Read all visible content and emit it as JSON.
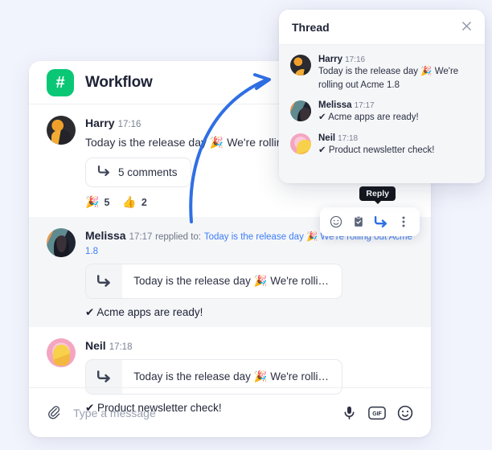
{
  "channel": {
    "icon": "hash-icon",
    "name": "Workflow",
    "accent_color": "#0ac776"
  },
  "messages": [
    {
      "author": "Harry",
      "time": "17:16",
      "text": "Today is the release day 🎉 We're rolling out Acme 1.8",
      "comments_label": "5 comments",
      "reactions": [
        {
          "emoji": "🎉",
          "count": "5"
        },
        {
          "emoji": "👍",
          "count": "2"
        }
      ]
    },
    {
      "author": "Melissa",
      "time": "17:17",
      "replied_label": "repplied to:",
      "replied_link": "Today is the release day 🎉 We're rolling out Acme 1.8",
      "quote_text": "Today is the release day 🎉 We're rolling ...",
      "text": "✔ Acme apps are ready!"
    },
    {
      "author": "Neil",
      "time": "17:18",
      "quote_text": "Today is the release day 🎉 We're rolling ...",
      "text": "✔ Product newsletter check!"
    }
  ],
  "action_bar": {
    "tooltip": "Reply",
    "buttons": [
      "emoji-icon",
      "task-icon",
      "reply-icon",
      "more-icon"
    ]
  },
  "composer": {
    "attach_icon": "paperclip-icon",
    "placeholder": "Type a message",
    "value": "",
    "icons": [
      "microphone-icon",
      "gif-icon",
      "emoji-icon"
    ],
    "gif_label": "GIF"
  },
  "thread": {
    "title": "Thread",
    "close_icon": "close-icon",
    "messages": [
      {
        "author": "Harry",
        "time": "17:16",
        "text": "Today is the release day 🎉 We're rolling out Acme 1.8"
      },
      {
        "author": "Melissa",
        "time": "17:17",
        "text": "✔ Acme apps are ready!"
      },
      {
        "author": "Neil",
        "time": "17:18",
        "text": "✔ Product newsletter check!"
      }
    ]
  },
  "annotation": {
    "arrow_color": "#2f6fe4"
  }
}
